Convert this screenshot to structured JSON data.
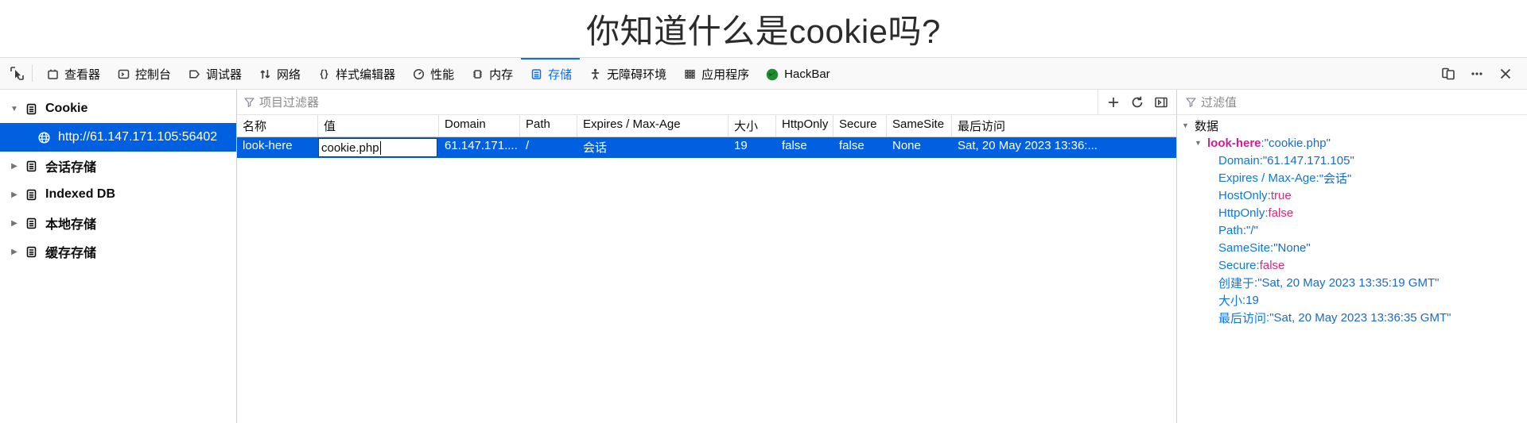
{
  "page": {
    "title": "你知道什么是cookie吗?"
  },
  "devtools": {
    "picker_icon": "element-picker-icon",
    "tabs": [
      {
        "label": "查看器",
        "icon": "inspector-icon",
        "active": false
      },
      {
        "label": "控制台",
        "icon": "console-icon",
        "active": false
      },
      {
        "label": "调试器",
        "icon": "debugger-icon",
        "active": false
      },
      {
        "label": "网络",
        "icon": "network-icon",
        "active": false
      },
      {
        "label": "样式编辑器",
        "icon": "style-editor-icon",
        "active": false
      },
      {
        "label": "性能",
        "icon": "performance-icon",
        "active": false
      },
      {
        "label": "内存",
        "icon": "memory-icon",
        "active": false
      },
      {
        "label": "存储",
        "icon": "storage-icon",
        "active": true
      },
      {
        "label": "无障碍环境",
        "icon": "accessibility-icon",
        "active": false
      },
      {
        "label": "应用程序",
        "icon": "application-icon",
        "active": false
      },
      {
        "label": "HackBar",
        "icon": "hackbar-icon",
        "active": false
      }
    ],
    "right_buttons": [
      {
        "name": "responsive-design-mode-button",
        "icon": "devices-icon"
      },
      {
        "name": "more-options-button",
        "icon": "ellipsis-icon"
      },
      {
        "name": "close-devtools-button",
        "icon": "close-icon"
      }
    ],
    "accent_color": "#0a6cff",
    "selection_color": "#0060df"
  },
  "sidebar": {
    "items": [
      {
        "label": "Cookie",
        "level": 0,
        "expanded": true,
        "twisty": "▼",
        "icon": "storage-type-icon",
        "selected": false
      },
      {
        "label": "http://61.147.171.105:56402",
        "level": 1,
        "expanded": null,
        "twisty": "",
        "icon": "globe-icon",
        "selected": true
      },
      {
        "label": "会话存储",
        "level": 0,
        "expanded": false,
        "twisty": "▶",
        "icon": "storage-type-icon",
        "selected": false
      },
      {
        "label": "Indexed DB",
        "level": 0,
        "expanded": false,
        "twisty": "▶",
        "icon": "storage-type-icon",
        "selected": false
      },
      {
        "label": "本地存储",
        "level": 0,
        "expanded": false,
        "twisty": "▶",
        "icon": "storage-type-icon",
        "selected": false
      },
      {
        "label": "缓存存储",
        "level": 0,
        "expanded": false,
        "twisty": "▶",
        "icon": "storage-type-icon",
        "selected": false
      }
    ]
  },
  "main": {
    "filter_placeholder": "项目过滤器",
    "toolbar_buttons": [
      {
        "name": "add-item-button",
        "icon": "plus-icon"
      },
      {
        "name": "refresh-items-button",
        "icon": "refresh-icon"
      },
      {
        "name": "toggle-sidebar-button",
        "icon": "panel-toggle-icon"
      }
    ],
    "columns": [
      {
        "key": "name",
        "label": "名称"
      },
      {
        "key": "value",
        "label": "值"
      },
      {
        "key": "domain",
        "label": "Domain"
      },
      {
        "key": "path",
        "label": "Path"
      },
      {
        "key": "expires",
        "label": "Expires / Max-Age"
      },
      {
        "key": "size",
        "label": "大小"
      },
      {
        "key": "httponly",
        "label": "HttpOnly"
      },
      {
        "key": "secure",
        "label": "Secure"
      },
      {
        "key": "samesite",
        "label": "SameSite"
      },
      {
        "key": "last",
        "label": "最后访问"
      }
    ],
    "row": {
      "name": "look-here",
      "value_editing": "cookie.php",
      "domain": "61.147.171....",
      "path": "/",
      "expires": "会话",
      "size": "19",
      "httponly": "false",
      "secure": "false",
      "samesite": "None",
      "last": "Sat, 20 May 2023 13:36:..."
    }
  },
  "details": {
    "filter_placeholder": "过滤值",
    "root_label": "数据",
    "root_twisty": "▼",
    "cookie_twisty": "▼",
    "cookie_key": "look-here",
    "cookie_value": "\"cookie.php\"",
    "props": [
      {
        "key": "Domain",
        "value": "\"61.147.171.105\"",
        "vtype": "str"
      },
      {
        "key": "Expires / Max-Age",
        "value": "\"会话\"",
        "vtype": "str"
      },
      {
        "key": "HostOnly",
        "value": "true",
        "vtype": "bool"
      },
      {
        "key": "HttpOnly",
        "value": "false",
        "vtype": "bool"
      },
      {
        "key": "Path",
        "value": "\"/\"",
        "vtype": "str"
      },
      {
        "key": "SameSite",
        "value": "\"None\"",
        "vtype": "str"
      },
      {
        "key": "Secure",
        "value": "false",
        "vtype": "bool"
      },
      {
        "key": "创建于",
        "value": "\"Sat, 20 May 2023 13:35:19 GMT\"",
        "vtype": "str"
      },
      {
        "key": "大小",
        "value": "19",
        "vtype": "num"
      },
      {
        "key": "最后访问",
        "value": "\"Sat, 20 May 2023 13:36:35 GMT\"",
        "vtype": "str"
      }
    ]
  }
}
